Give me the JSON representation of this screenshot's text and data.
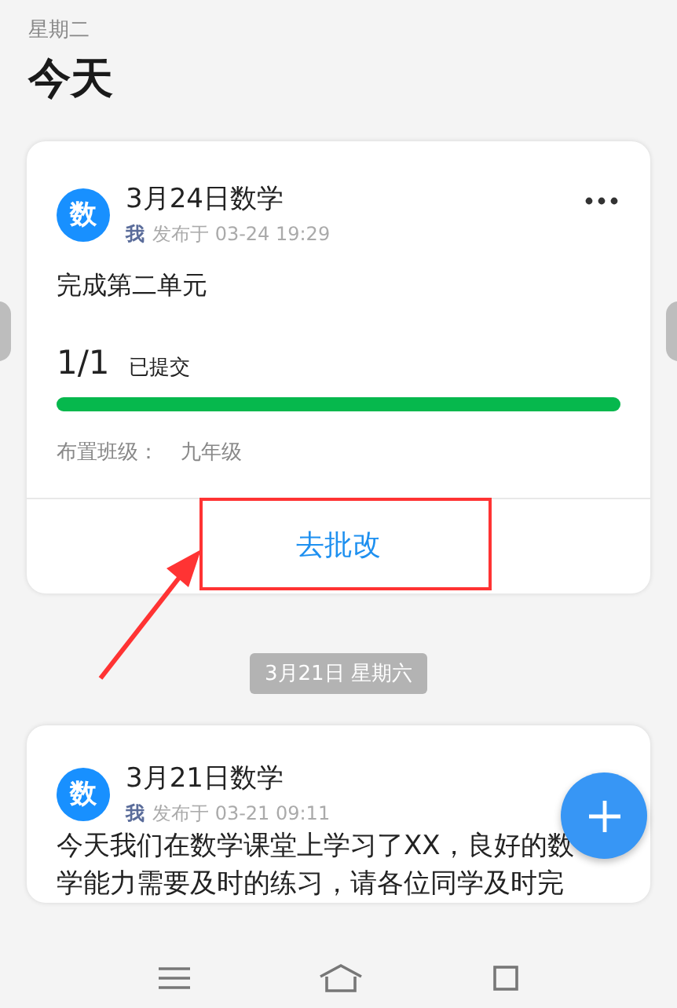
{
  "header": {
    "weekday": "星期二",
    "title": "今天"
  },
  "cards": [
    {
      "avatar": "数",
      "title": "3月24日数学",
      "author": "我",
      "posted": "发布于 03-24 19:29",
      "has_menu": true,
      "body": "完成第二单元",
      "count": "1/1",
      "count_label": "已提交",
      "level": 1,
      "class_label": "布置班级：",
      "class_value": "九年级",
      "action": "去批改"
    },
    {
      "date_divider": "3月21日 星期六",
      "avatar": "数",
      "title": "3月21日数学",
      "author": "我",
      "posted": "发布于 03-21 09:11",
      "has_menu": false,
      "body_lines": [
        "今天我们在数学课堂上学习了XX，良好的数",
        "学能力需要及时的练习，请各位同学及时完"
      ]
    }
  ]
}
